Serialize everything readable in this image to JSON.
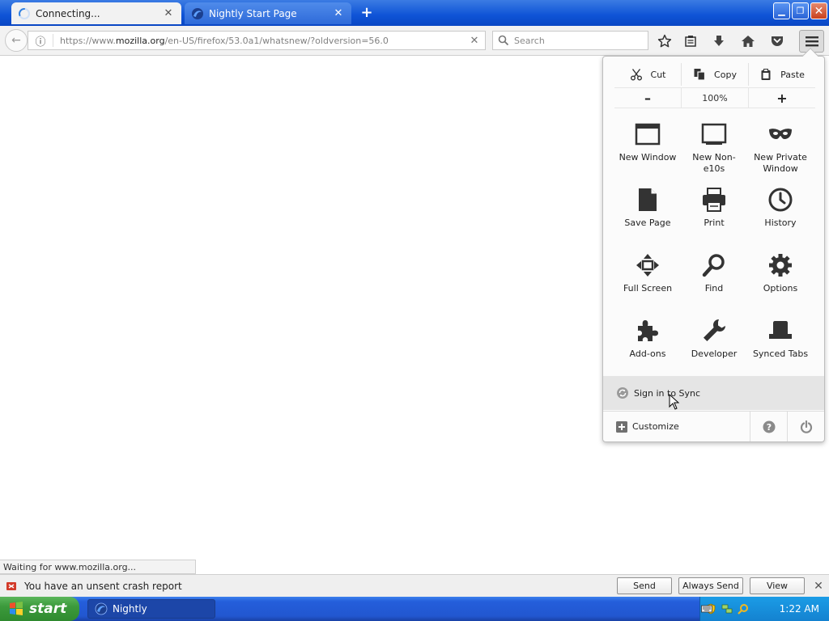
{
  "tabs": [
    {
      "label": "Connecting...",
      "close": "✕"
    },
    {
      "label": "Nightly Start Page",
      "close": "✕"
    }
  ],
  "new_tab": "+",
  "window_buttons": {
    "minimize": "▁",
    "maximize": "❐",
    "close": "✕"
  },
  "navbar": {
    "back": "←",
    "info": "ⓘ",
    "url_prefix": "https://www.",
    "url_domain": "mozilla.org",
    "url_rest": "/en-US/firefox/53.0a1/whatsnew/?oldversion=56.0",
    "stop": "✕",
    "search_placeholder": "Search"
  },
  "panel": {
    "edit": {
      "cut": "Cut",
      "copy": "Copy",
      "paste": "Paste"
    },
    "zoom": {
      "minus": "–",
      "value": "100%",
      "plus": "+"
    },
    "items": [
      {
        "label": "New Window",
        "icon": "new-window-icon"
      },
      {
        "label": "New Non-e10s",
        "icon": "non-e10s-icon"
      },
      {
        "label": "New Private Window",
        "icon": "private-mask-icon"
      },
      {
        "label": "Save Page",
        "icon": "save-page-icon"
      },
      {
        "label": "Print",
        "icon": "printer-icon"
      },
      {
        "label": "History",
        "icon": "clock-icon"
      },
      {
        "label": "Full Screen",
        "icon": "fullscreen-icon"
      },
      {
        "label": "Find",
        "icon": "magnifier-icon"
      },
      {
        "label": "Options",
        "icon": "gear-icon"
      },
      {
        "label": "Add-ons",
        "icon": "puzzle-icon"
      },
      {
        "label": "Developer",
        "icon": "wrench-icon"
      },
      {
        "label": "Synced Tabs",
        "icon": "synced-tabs-icon"
      }
    ],
    "sync": "Sign in to Sync",
    "customize": "Customize",
    "help": "?",
    "quit": "⏻"
  },
  "status": "Waiting for www.mozilla.org...",
  "notification": {
    "text": "You have an unsent crash report",
    "buttons": [
      "Send",
      "Always Send",
      "View"
    ],
    "close": "✕"
  },
  "taskbar": {
    "start": "start",
    "item": "Nightly",
    "clock": "1:22 AM"
  },
  "colors": {
    "taskbar_blue": "#245edb",
    "start_green": "#3c9a3c",
    "titlebar_blue": "#0e53d6",
    "panel_bg": "#fbfbfb",
    "icon_dark": "#3a3a3a"
  }
}
